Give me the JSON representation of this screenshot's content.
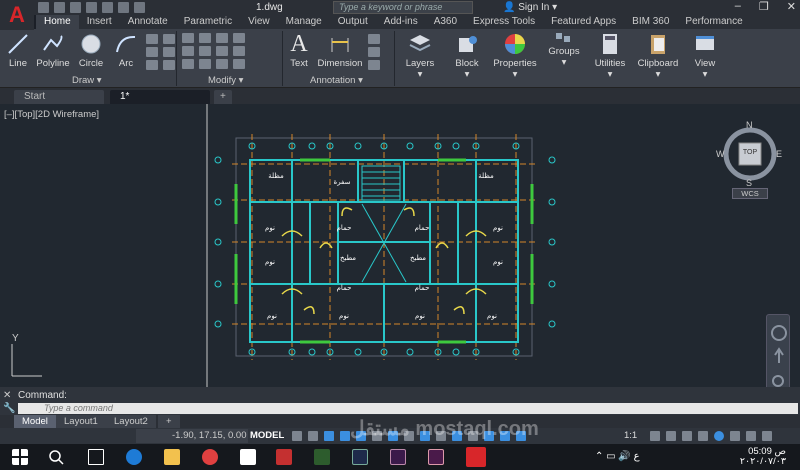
{
  "app": {
    "logo": "A",
    "filename": "1.dwg",
    "search_placeholder": "Type a keyword or phrase",
    "signin": "Sign In"
  },
  "ribbon_tabs": [
    "Home",
    "Insert",
    "Annotate",
    "Parametric",
    "View",
    "Manage",
    "Output",
    "Add-ins",
    "A360",
    "Express Tools",
    "Featured Apps",
    "BIM 360",
    "Performance"
  ],
  "ribbon": {
    "draw": {
      "line": "Line",
      "polyline": "Polyline",
      "circle": "Circle",
      "arc": "Arc",
      "panel": "Draw ▾"
    },
    "modify": {
      "panel": "Modify ▾"
    },
    "annotation": {
      "text": "Text",
      "dimension": "Dimension",
      "panel": "Annotation ▾"
    },
    "layers": "Layers",
    "block": "Block",
    "properties": "Properties",
    "groups": "Groups",
    "utilities": "Utilities",
    "clipboard": "Clipboard",
    "view": "View"
  },
  "file_tabs": {
    "start": "Start",
    "active": "1*",
    "add": "+"
  },
  "viewport": {
    "label": "[–][Top][2D Wireframe]",
    "cube_top": "TOP",
    "north": "N",
    "south": "S",
    "east": "E",
    "west": "W",
    "wcs": "WCS",
    "ucs_y": "Y"
  },
  "plan_labels": {
    "sofra": "سفرة",
    "mazla1": "مظلة",
    "mazla2": "مظلة",
    "nom": "نوم",
    "hammam": "حمام",
    "matbakh": "مطبخ"
  },
  "command": {
    "label": "Command:",
    "placeholder": "Type a command"
  },
  "layout_tabs": [
    "Model",
    "Layout1",
    "Layout2",
    "+"
  ],
  "status": {
    "coords": "-1.90, 17.15, 0.00",
    "model": "MODEL",
    "scale": "1:1"
  },
  "clock": {
    "time": "05:09 ص",
    "date": "٢٠٢٠/٠٧/٠٣"
  },
  "watermark": "مستقل mostaql.com",
  "colors": {
    "wall": "#29c7c9",
    "axis": "#d4862a",
    "door": "#e8d84a",
    "green": "#3ec93e",
    "accent": "#d8262a"
  }
}
